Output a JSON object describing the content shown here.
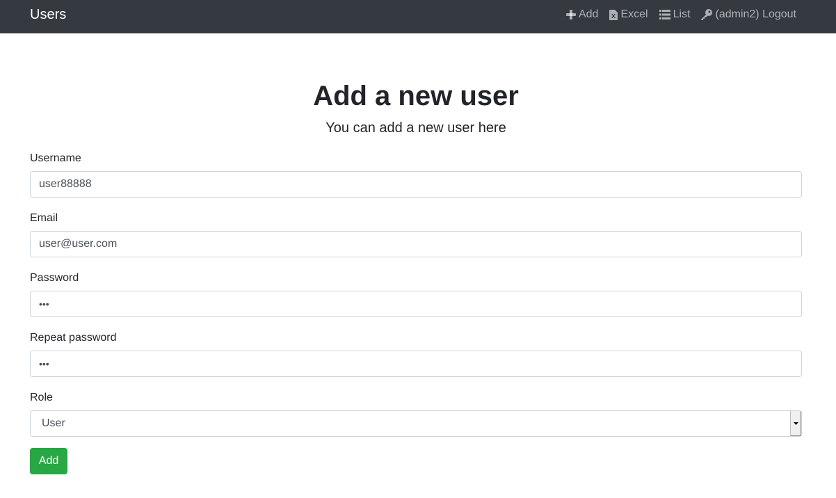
{
  "navbar": {
    "brand": "Users",
    "links": [
      {
        "label": "Add",
        "icon": "plus-icon"
      },
      {
        "label": "Excel",
        "icon": "file-excel-icon"
      },
      {
        "label": "List",
        "icon": "list-icon"
      },
      {
        "label": "(admin2) Logout",
        "icon": "key-icon"
      }
    ]
  },
  "header": {
    "title": "Add a new user",
    "subtitle": "You can add a new user here"
  },
  "form": {
    "username": {
      "label": "Username",
      "value": "user88888"
    },
    "email": {
      "label": "Email",
      "value": "user@user.com"
    },
    "password": {
      "label": "Password",
      "value": "•••"
    },
    "repeat_password": {
      "label": "Repeat password",
      "value": "•••"
    },
    "role": {
      "label": "Role",
      "value": "User"
    },
    "submit_label": "Add"
  },
  "colors": {
    "navbar_bg": "#343a40",
    "button_bg": "#28a745"
  }
}
